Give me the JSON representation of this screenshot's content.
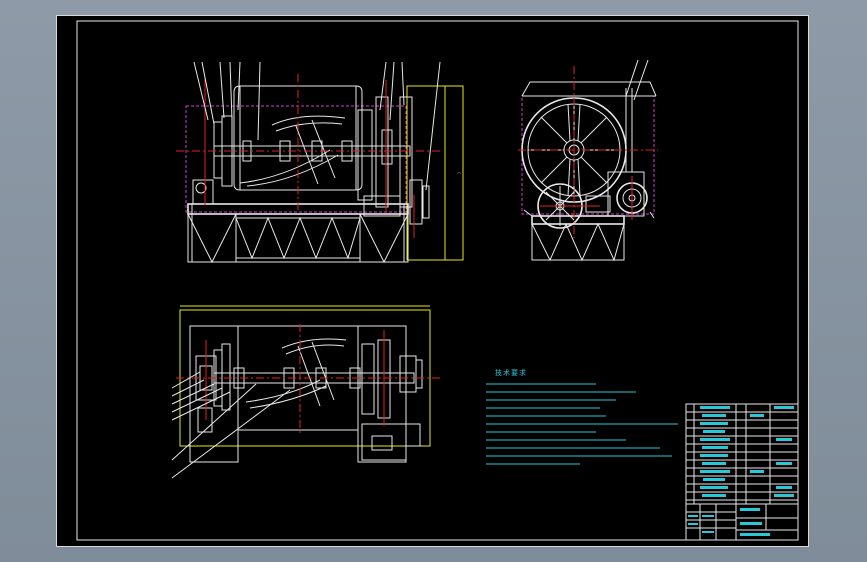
{
  "drawing": {
    "technical_requirements_title": "技术要求"
  },
  "colors": {
    "background": "#8e9aa7",
    "sheet": "#000000",
    "outline": "#e8e8e8",
    "center_lines": "#e02020",
    "hidden_lines": "#d23cd2",
    "dimension_lines": "#e8e81a",
    "notes_text": "#28c8d8"
  }
}
